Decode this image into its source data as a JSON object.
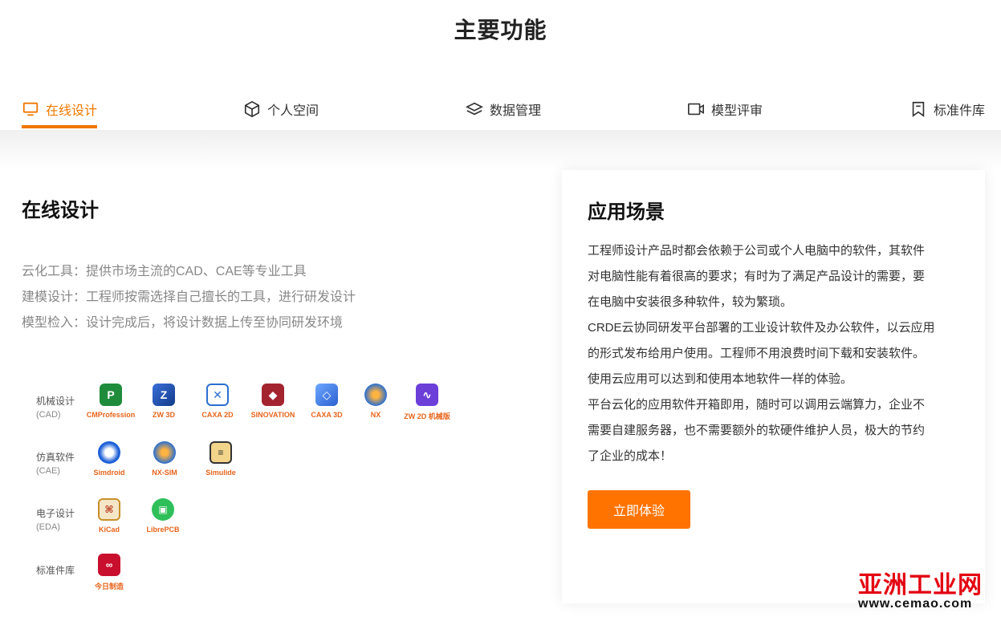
{
  "page_title": "主要功能",
  "tabs": [
    {
      "label": "在线设计",
      "icon": "monitor-icon",
      "active": true
    },
    {
      "label": "个人空间",
      "icon": "cube-icon",
      "active": false
    },
    {
      "label": "数据管理",
      "icon": "layers-icon",
      "active": false
    },
    {
      "label": "模型评审",
      "icon": "video-camera-icon",
      "active": false
    },
    {
      "label": "标准件库",
      "icon": "bookmark-icon",
      "active": false
    }
  ],
  "main": {
    "heading": "在线设计",
    "features": [
      "云化工具：提供市场主流的CAD、CAE等专业工具",
      "建模设计：工程师按需选择自己擅长的工具，进行研发设计",
      "模型检入：设计完成后，将设计数据上传至协同研发环境"
    ],
    "categories": [
      {
        "name": "机械设计",
        "sub": "(CAD)",
        "apps": [
          "CMProfession",
          "ZW 3D",
          "CAXA 2D",
          "SINOVATION",
          "CAXA 3D",
          "NX",
          "ZW 2D 机械版"
        ]
      },
      {
        "name": "仿真软件",
        "sub": "(CAE)",
        "apps": [
          "Simdroid",
          "NX-SIM",
          "Simulide"
        ]
      },
      {
        "name": "电子设计",
        "sub": "(EDA)",
        "apps": [
          "KiCad",
          "LibrePCB"
        ]
      },
      {
        "name": "标准件库",
        "sub": "",
        "apps": [
          "今日制造"
        ]
      }
    ]
  },
  "card": {
    "title": "应用场景",
    "para1_lines": [
      "工程师设计产品时都会依赖于公司或个人电脑中的软件，其软件",
      "对电脑性能有着很高的要求；有时为了满足产品设计的需要，要",
      "在电脑中安装很多种软件，较为繁琐。"
    ],
    "para2_lines": [
      "CRDE云协同研发平台部署的工业设计软件及办公软件，以云应用",
      "的形式发布给用户使用。工程师不用浪费时间下载和安装软件。",
      "使用云应用可以达到和使用本地软件一样的体验。"
    ],
    "para3_lines": [
      "平台云化的应用软件开箱即用，随时可以调用云端算力，企业不",
      "需要自建服务器，也不需要额外的软硬件维护人员，极大的节约",
      "了企业的成本！"
    ],
    "cta_label": "立即体验"
  },
  "watermark": {
    "main": "亚洲工业网",
    "url": "www.cemao.com"
  },
  "colors": {
    "accent": "#f07800",
    "button": "#ff7300",
    "watermark_red": "#e30613"
  }
}
